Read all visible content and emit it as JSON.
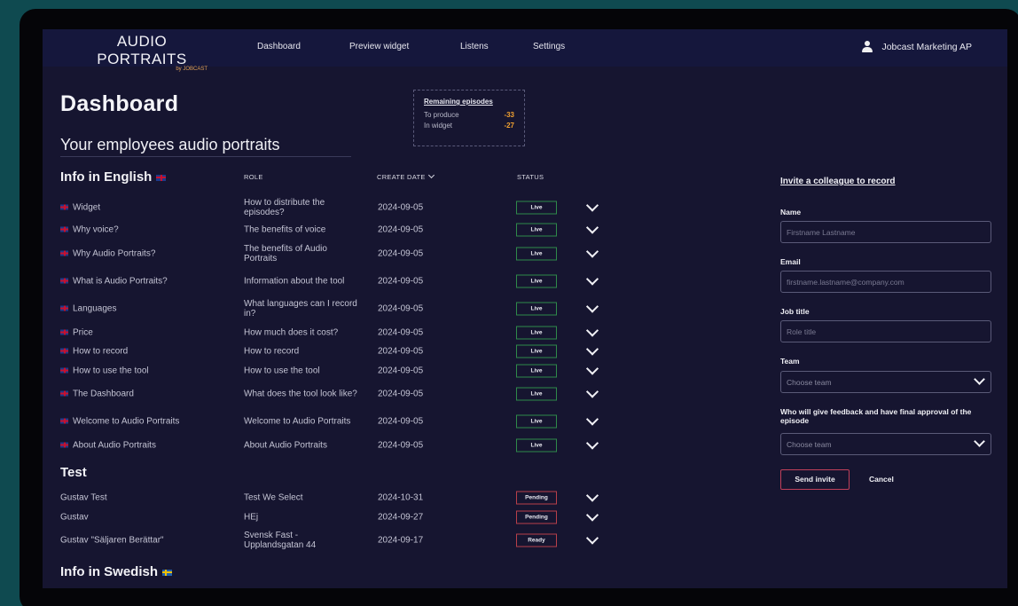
{
  "brand": {
    "name": "AUDIO PORTRAITS",
    "sub": "by JOBCAST"
  },
  "nav": [
    "Dashboard",
    "Preview widget",
    "Listens",
    "Settings"
  ],
  "user": {
    "name": "Jobcast Marketing AP"
  },
  "page": {
    "title": "Dashboard",
    "subtitle": "Your employees audio portraits"
  },
  "remaining": {
    "title": "Remaining episodes",
    "produce_label": "To produce",
    "produce_value": "-33",
    "widget_label": "In widget",
    "widget_value": "-27"
  },
  "columns": {
    "role": "ROLE",
    "date": "CREATE DATE",
    "status": "STATUS"
  },
  "sections": {
    "english": "Info in English",
    "test": "Test",
    "swedish": "Info in Swedish"
  },
  "english_rows": [
    {
      "name": "Widget",
      "role": "How to distribute the episodes?",
      "date": "2024-09-05",
      "status": "Live"
    },
    {
      "name": "Why voice?",
      "role": "The benefits of voice",
      "date": "2024-09-05",
      "status": "Live"
    },
    {
      "name": "Why Audio Portraits?",
      "role": "The benefits of Audio Portraits",
      "date": "2024-09-05",
      "status": "Live"
    },
    {
      "name": "What is Audio Portraits?",
      "role": "Information about the tool",
      "date": "2024-09-05",
      "status": "Live"
    },
    {
      "name": "Languages",
      "role": "What languages can I record in?",
      "date": "2024-09-05",
      "status": "Live"
    },
    {
      "name": "Price",
      "role": "How much does it cost?",
      "date": "2024-09-05",
      "status": "Live"
    },
    {
      "name": "How to record",
      "role": "How to record",
      "date": "2024-09-05",
      "status": "Live"
    },
    {
      "name": "How to use the tool",
      "role": "How to use the tool",
      "date": "2024-09-05",
      "status": "Live"
    },
    {
      "name": "The Dashboard",
      "role": "What does the tool look like?",
      "date": "2024-09-05",
      "status": "Live"
    },
    {
      "name": "Welcome to Audio Portraits",
      "role": "Welcome to Audio Portraits",
      "date": "2024-09-05",
      "status": "Live"
    },
    {
      "name": "About Audio Portraits",
      "role": "About Audio Portraits",
      "date": "2024-09-05",
      "status": "Live"
    }
  ],
  "test_rows": [
    {
      "name": "Gustav Test",
      "role": "Test We Select",
      "date": "2024-10-31",
      "status": "Pending"
    },
    {
      "name": "Gustav",
      "role": "HEj",
      "date": "2024-09-27",
      "status": "Pending"
    },
    {
      "name": "Gustav \"Säljaren Berättar\"",
      "role": "Svensk Fast - Upplandsgatan 44",
      "date": "2024-09-17",
      "status": "Ready"
    }
  ],
  "invite": {
    "title": "Invite a colleague to record",
    "name_label": "Name",
    "name_placeholder": "Firstname Lastname",
    "email_label": "Email",
    "email_placeholder": "firstname.lastname@company.com",
    "job_label": "Job title",
    "job_placeholder": "Role title",
    "team_label": "Team",
    "team_value": "Choose team",
    "approval_label": "Who will give feedback and have final approval of the episode",
    "approval_value": "Choose team",
    "send_label": "Send invite",
    "cancel_label": "Cancel"
  },
  "colors": {
    "background": "#161530",
    "topbar": "#15173c",
    "live": "#2f8a4a",
    "pending": "#b8404a",
    "accent": "#f0a030"
  }
}
